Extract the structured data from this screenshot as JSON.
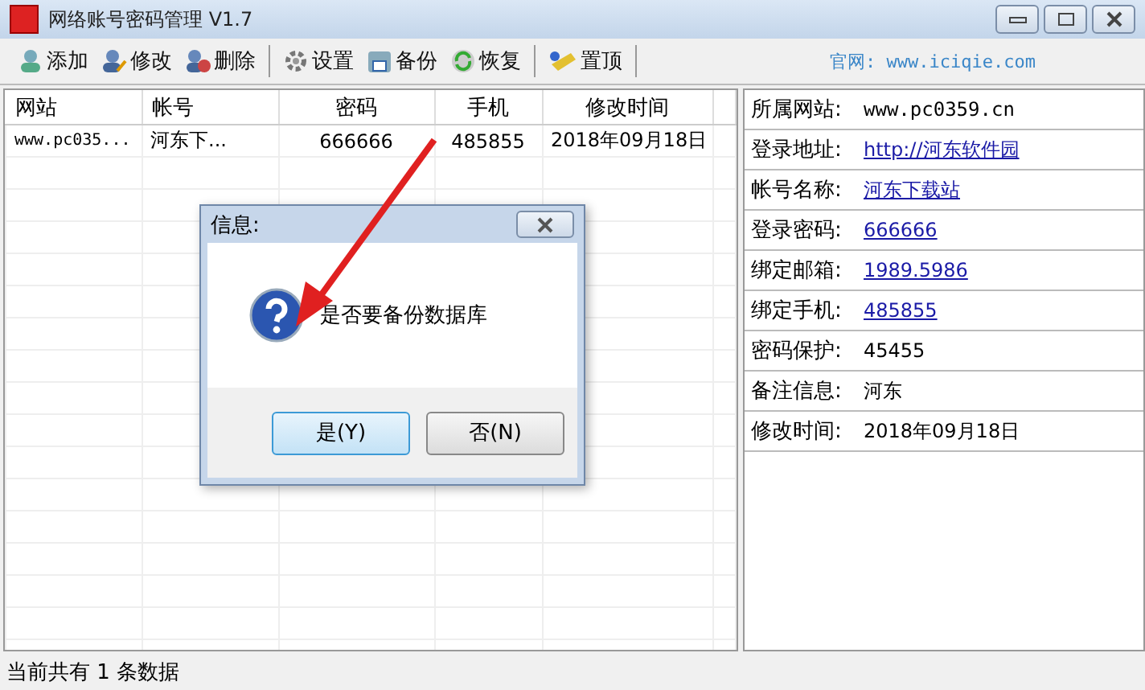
{
  "window": {
    "title": "网络账号密码管理 V1.7"
  },
  "toolbar": {
    "buttons": [
      {
        "label": "添加"
      },
      {
        "label": "修改"
      },
      {
        "label": "删除"
      },
      {
        "label": "设置"
      },
      {
        "label": "备份"
      },
      {
        "label": "恢复"
      },
      {
        "label": "置顶"
      }
    ],
    "website": "官网: www.iciqie.com"
  },
  "table": {
    "columns": [
      "网站",
      "帐号",
      "密码",
      "手机",
      "修改时间"
    ],
    "rows": [
      [
        "www.pc035...",
        "河东下...",
        "666666",
        "485855",
        "2018年09月18日"
      ]
    ]
  },
  "details": [
    {
      "label": "所属网站:",
      "value": "www.pc0359.cn",
      "kind": "text"
    },
    {
      "label": "登录地址:",
      "value": "http://河东软件园",
      "kind": "link"
    },
    {
      "label": "帐号名称:",
      "value": "河东下载站",
      "kind": "link"
    },
    {
      "label": "登录密码:",
      "value": "666666",
      "kind": "link"
    },
    {
      "label": "绑定邮箱:",
      "value": "1989.5986",
      "kind": "link"
    },
    {
      "label": "绑定手机:",
      "value": "485855",
      "kind": "link"
    },
    {
      "label": "密码保护:",
      "value": "45455",
      "kind": "text"
    },
    {
      "label": "备注信息:",
      "value": "河东",
      "kind": "text"
    },
    {
      "label": "修改时间:",
      "value": "2018年09月18日",
      "kind": "text"
    }
  ],
  "dialog": {
    "title": "信息:",
    "message": "是否要备份数据库",
    "buttons": [
      {
        "label": "是(Y)",
        "selected": true
      },
      {
        "label": "否(N)",
        "selected": false
      }
    ]
  },
  "status_bar": "当前共有 1 条数据"
}
